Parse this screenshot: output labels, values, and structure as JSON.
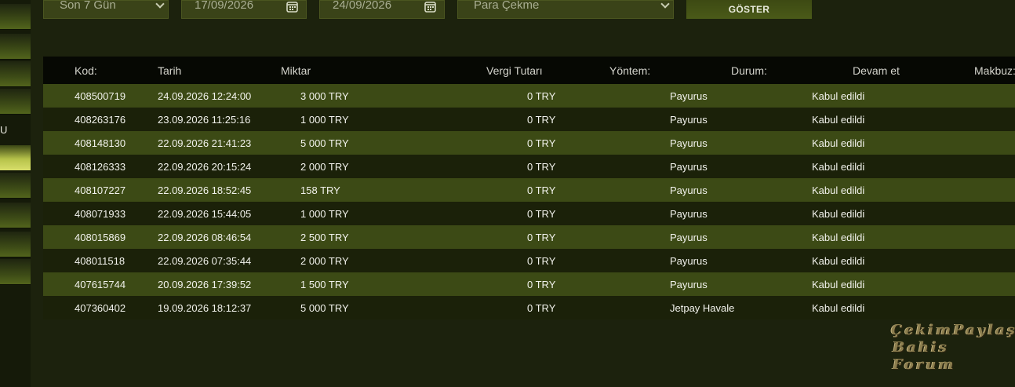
{
  "sidebar": {
    "partial_label": "U"
  },
  "filters": {
    "period_select": "Son 7 Gün",
    "date_from": "17/09/2026",
    "date_to": "24/09/2026",
    "type_select": "Para Çekme",
    "show_button": "GÖSTER"
  },
  "table": {
    "headers": [
      "Kod:",
      "Tarih",
      "Miktar",
      "Vergi Tutarı",
      "Yöntem:",
      "Durum:",
      "Devam et",
      "Makbuz:"
    ],
    "rows": [
      {
        "kod": "408500719",
        "tarih": "24.09.2026 12:24:00",
        "miktar": "3 000 TRY",
        "vergi": "0 TRY",
        "yontem": "Payurus",
        "durum": "Kabul edildi"
      },
      {
        "kod": "408263176",
        "tarih": "23.09.2026 11:25:16",
        "miktar": "1 000 TRY",
        "vergi": "0 TRY",
        "yontem": "Payurus",
        "durum": "Kabul edildi"
      },
      {
        "kod": "408148130",
        "tarih": "22.09.2026 21:41:23",
        "miktar": "5 000 TRY",
        "vergi": "0 TRY",
        "yontem": "Payurus",
        "durum": "Kabul edildi"
      },
      {
        "kod": "408126333",
        "tarih": "22.09.2026 20:15:24",
        "miktar": "2 000 TRY",
        "vergi": "0 TRY",
        "yontem": "Payurus",
        "durum": "Kabul edildi"
      },
      {
        "kod": "408107227",
        "tarih": "22.09.2026 18:52:45",
        "miktar": "158 TRY",
        "vergi": "0 TRY",
        "yontem": "Payurus",
        "durum": "Kabul edildi"
      },
      {
        "kod": "408071933",
        "tarih": "22.09.2026 15:44:05",
        "miktar": "1 000 TRY",
        "vergi": "0 TRY",
        "yontem": "Payurus",
        "durum": "Kabul edildi"
      },
      {
        "kod": "408015869",
        "tarih": "22.09.2026 08:46:54",
        "miktar": "2 500 TRY",
        "vergi": "0 TRY",
        "yontem": "Payurus",
        "durum": "Kabul edildi"
      },
      {
        "kod": "408011518",
        "tarih": "22.09.2026 07:35:44",
        "miktar": "2 000 TRY",
        "vergi": "0 TRY",
        "yontem": "Payurus",
        "durum": "Kabul edildi"
      },
      {
        "kod": "407615744",
        "tarih": "20.09.2026 17:39:52",
        "miktar": "1 500 TRY",
        "vergi": "0 TRY",
        "yontem": "Payurus",
        "durum": "Kabul edildi"
      },
      {
        "kod": "407360402",
        "tarih": "19.09.2026 18:12:37",
        "miktar": "5 000 TRY",
        "vergi": "0 TRY",
        "yontem": "Jetpay Havale",
        "durum": "Kabul edildi"
      }
    ]
  },
  "watermark": {
    "line1": "ÇekimPaylaş",
    "line2": "Bahis Forum"
  },
  "colors": {
    "background": "#1c220d",
    "row_odd": "#3c4a15",
    "row_even": "#1b2109",
    "header_bg": "#060803"
  }
}
